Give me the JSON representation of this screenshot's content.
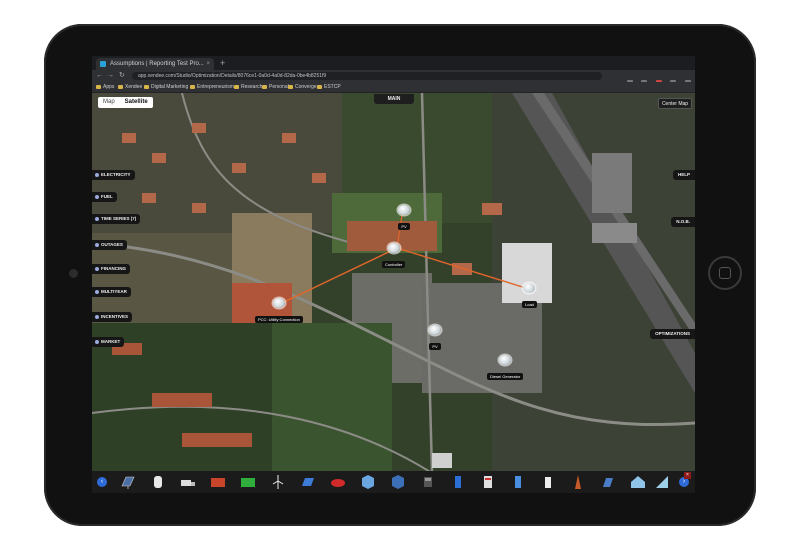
{
  "browser": {
    "tab_title": "Assumptions | Reporting Test Pro...",
    "tab_close": "×",
    "new_tab": "+",
    "url": "app.xendee.com/Studio/Optimization/Details/8076ce1-0a0d-4a0d-82da-0be4b8251f9",
    "bookmarks": [
      "Apps",
      "Xendee",
      "Digital Marketing",
      "Entrepreneurism",
      "Research",
      "Personal",
      "Converge",
      "ESTCP"
    ]
  },
  "map": {
    "mode_map": "Map",
    "mode_satellite": "Satellite",
    "main_label": "MAIN",
    "center_label": "Center Map",
    "left_buttons": [
      "ELECTRICITY",
      "FUEL",
      "TIME SERIES (7)",
      "OUTAGES",
      "FINANCING",
      "MULTIYEAR",
      "INCENTIVES",
      "MARKET"
    ],
    "right_buttons": [
      "HELP",
      "N.O.B.",
      "OPTIMIZATIONS"
    ],
    "nodes": {
      "pv_top": "PV",
      "controller": "Controller",
      "pcc": "PCC: Utility Connection",
      "load": "Load",
      "pv_bottom": "PV",
      "diesel": "Diesel Generator"
    }
  },
  "toolbar": {
    "prev": "‹",
    "next": "›",
    "close": "×",
    "icons": [
      "solar-panel-icon",
      "tank-icon",
      "truck-icon",
      "container-red-icon",
      "container-green-icon",
      "wind-turbine-icon",
      "battery-panel-icon",
      "fuel-truck-icon",
      "building-blue-icon",
      "storage-cube-icon",
      "device-icon",
      "phone-icon",
      "cabinet-icon",
      "inverter-icon",
      "meter-icon",
      "charger-icon",
      "tower-icon",
      "shed-icon",
      "ev-icon"
    ]
  }
}
